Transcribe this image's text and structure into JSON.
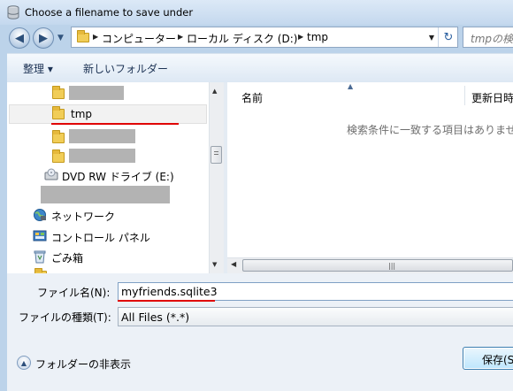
{
  "window": {
    "title": "Choose a filename to save under"
  },
  "address": {
    "parts": [
      "コンピューター",
      "ローカル ディスク (D:)",
      "tmp"
    ],
    "search_placeholder": "tmpの検索"
  },
  "toolbar": {
    "organize": "整理 ▾",
    "new_folder": "新しいフォルダー"
  },
  "tree": {
    "selected_folder": "tmp",
    "dvd_drive": "DVD RW ドライブ (E:)",
    "network": "ネットワーク",
    "control_panel": "コントロール パネル",
    "recycle_bin": "ごみ箱"
  },
  "list": {
    "col_name": "名前",
    "col_modified": "更新日時",
    "empty_message": "検索条件に一致する項目はありません"
  },
  "form": {
    "filename_label": "ファイル名(N):",
    "filename_value": "myfriends.sqlite3",
    "filetype_label": "ファイルの種類(T):",
    "filetype_value": "All Files (*.*)"
  },
  "footer": {
    "hide_folders": "フォルダーの非表示",
    "save_button": "保存(S)"
  }
}
